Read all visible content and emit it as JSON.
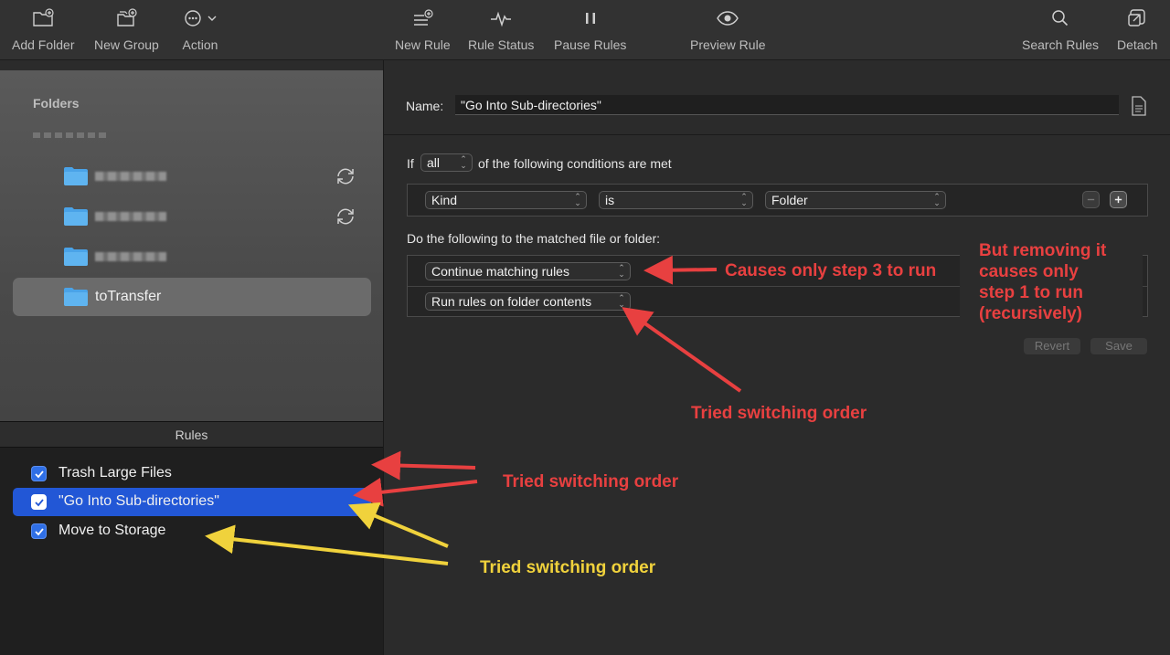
{
  "toolbar": {
    "add_folder": "Add Folder",
    "new_group": "New Group",
    "action": "Action",
    "new_rule": "New Rule",
    "rule_status": "Rule Status",
    "pause_rules": "Pause Rules",
    "preview_rule": "Preview Rule",
    "search_rules": "Search Rules",
    "detach": "Detach"
  },
  "sidebar": {
    "title": "Folders",
    "selected_folder": "toTransfer"
  },
  "rules": {
    "header": "Rules",
    "items": [
      {
        "label": "Trash Large Files",
        "checked": true
      },
      {
        "label": "\"Go Into Sub-directories\"",
        "checked": true
      },
      {
        "label": "Move to Storage",
        "checked": true
      }
    ]
  },
  "detail": {
    "name_label": "Name:",
    "name_value": "\"Go Into Sub-directories\"",
    "if_prefix": "If",
    "match_mode": "all",
    "if_suffix": "of the following conditions are met",
    "condition": {
      "attribute": "Kind",
      "operator": "is",
      "value": "Folder"
    },
    "do_text": "Do the following to the matched file or folder:",
    "actions": [
      "Continue matching rules",
      "Run rules on folder contents"
    ],
    "revert": "Revert",
    "save": "Save"
  },
  "annotations": {
    "causes_step3": "Causes only step 3 to run",
    "removing_line1": "But removing it",
    "removing_line2": "causes only",
    "removing_line3": "step 1 to run",
    "removing_line4": "(recursively)",
    "tried_1": "Tried switching order",
    "tried_2": "Tried switching order",
    "tried_3": "Tried switching order"
  },
  "colors": {
    "selection_blue": "#2257d6",
    "annotation_red": "#e84040",
    "annotation_yellow": "#f0d23c"
  }
}
